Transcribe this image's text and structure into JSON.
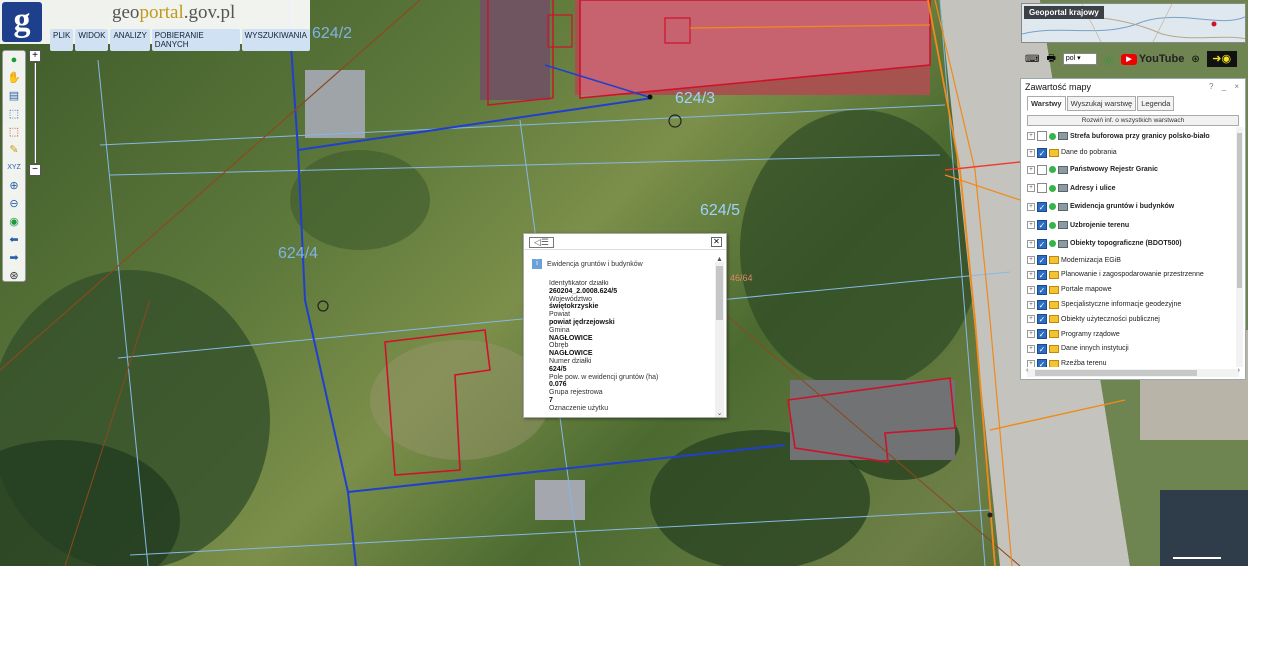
{
  "app": {
    "logo_letter": "g",
    "logo_prefix": "geo",
    "logo_accent": "portal",
    "logo_suffix": ".gov.pl"
  },
  "menu": [
    "PLIK",
    "WIDOK",
    "ANALIZY",
    "POBIERANIE DANYCH",
    "WYSZUKIWANIA"
  ],
  "map_labels": {
    "parcel_6243": "624/3",
    "parcel_6245": "624/5",
    "parcel_6244": "624/4",
    "parcel_6242": "624/2",
    "parcel_num_right": "46/64"
  },
  "overview": {
    "title": "Geoportal krajowy"
  },
  "topbar": {
    "language": "pol",
    "youtube": "YouTube"
  },
  "popup": {
    "layer_title": "Ewidencja gruntów i budynków",
    "fields": [
      {
        "label": "Identyfikator działki",
        "value": "260204_2.0008.624/5"
      },
      {
        "label": "Województwo",
        "value": "świętokrzyskie"
      },
      {
        "label": "Powiat",
        "value": "powiat jędrzejowski"
      },
      {
        "label": "Gmina",
        "value": "NAGŁOWICE"
      },
      {
        "label": "Obręb",
        "value": "NAGŁOWICE"
      },
      {
        "label": "Numer działki",
        "value": "624/5"
      },
      {
        "label": "Pole pow. w ewidencji gruntów (ha)",
        "value": "0.076"
      },
      {
        "label": "Grupa rejestrowa",
        "value": "7"
      },
      {
        "label": "Oznaczenie użytku",
        "value": ""
      }
    ]
  },
  "panel": {
    "title": "Zawartość mapy",
    "controls": "? _ ×",
    "tabs": [
      "Warstwy",
      "Wyszukaj warstwę",
      "Legenda"
    ],
    "expand_button": "Rozwiń inf. o wszystkich warstwach",
    "layers": [
      {
        "label": "Strefa buforowa przy granicy polsko-biało",
        "checked": false,
        "type": "service",
        "bold": true
      },
      {
        "label": "Dane do pobrania",
        "checked": true,
        "type": "folder",
        "bold": false
      },
      {
        "label": "Państwowy Rejestr Granic",
        "checked": false,
        "type": "service",
        "bold": true
      },
      {
        "label": "Adresy i ulice",
        "checked": false,
        "type": "service",
        "bold": true
      },
      {
        "label": "Ewidencja gruntów i budynków",
        "checked": true,
        "type": "service",
        "bold": true
      },
      {
        "label": "Uzbrojenie terenu",
        "checked": true,
        "type": "service",
        "bold": true
      },
      {
        "label": "Obiekty topograficzne (BDOT500)",
        "checked": true,
        "type": "service",
        "bold": true
      },
      {
        "label": "Modernizacja EGiB",
        "checked": true,
        "type": "folder",
        "bold": false
      },
      {
        "label": "Planowanie i zagospodarowanie przestrzenne",
        "checked": true,
        "type": "folder",
        "bold": false
      },
      {
        "label": "Portale mapowe",
        "checked": true,
        "type": "folder",
        "bold": false
      },
      {
        "label": "Specjalistyczne informacje geodezyjne",
        "checked": true,
        "type": "folder",
        "bold": false
      },
      {
        "label": "Obiekty użyteczności publicznej",
        "checked": true,
        "type": "folder",
        "bold": false
      },
      {
        "label": "Programy rządowe",
        "checked": true,
        "type": "folder",
        "bold": false
      },
      {
        "label": "Dane innych instytucji",
        "checked": true,
        "type": "folder",
        "bold": false
      },
      {
        "label": "Rzeźba terenu",
        "checked": true,
        "type": "folder",
        "bold": false
      }
    ]
  },
  "colors": {
    "brand": "#1e3f8c",
    "parcel_line": "#2a5bd6",
    "building_line": "#d0112b",
    "checkbox": "#2b6cc4"
  }
}
